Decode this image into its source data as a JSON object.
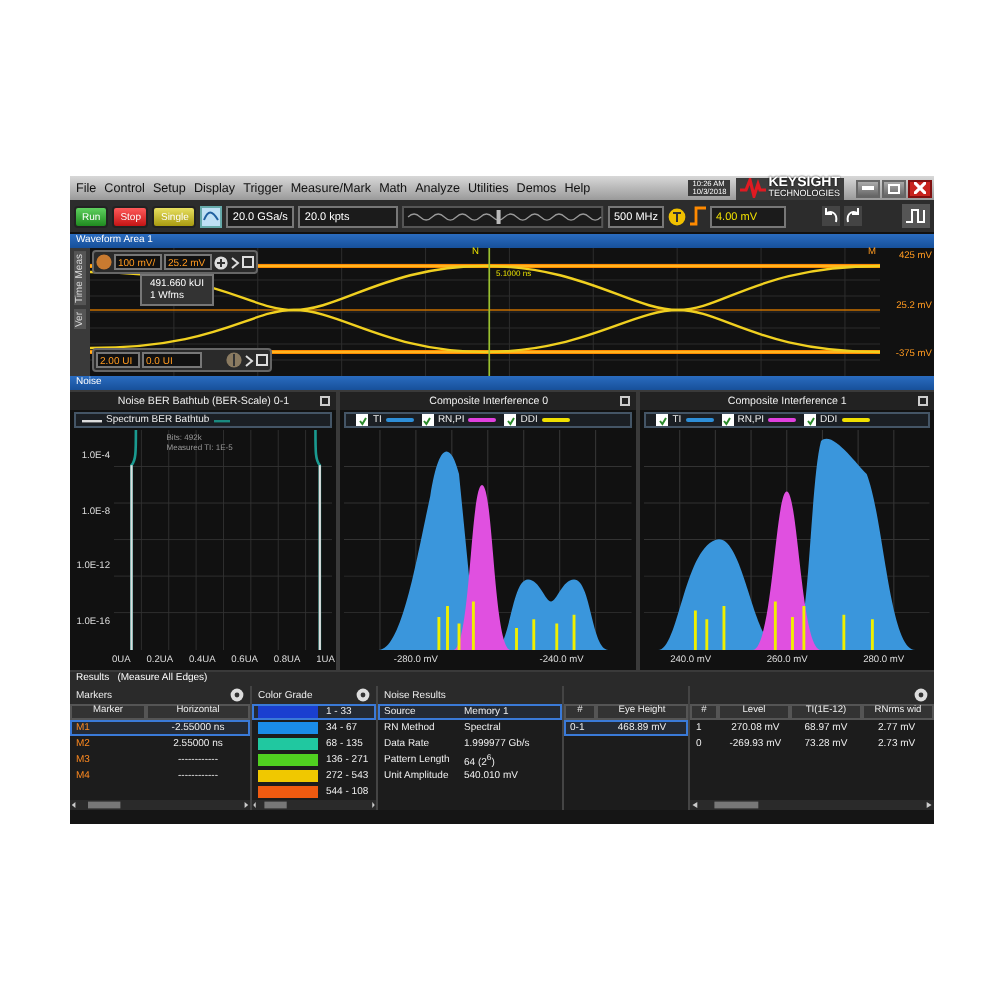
{
  "menu_bar": {
    "items": [
      "File",
      "Control",
      "Setup",
      "Display",
      "Trigger",
      "Measure/Mark",
      "Math",
      "Analyze",
      "Utilities",
      "Demos",
      "Help"
    ],
    "time": "10:26 AM",
    "date": "10/3/2018",
    "logo": {
      "name": "KEYSIGHT",
      "tagline": "TECHNOLOGIES"
    }
  },
  "toolbar": {
    "buttons": [
      {
        "label": "Run",
        "kind": "run"
      },
      {
        "label": "Stop",
        "kind": "stop"
      },
      {
        "label": "Single",
        "kind": "single"
      }
    ],
    "sample_rate": "20.0 GSa/s",
    "memory_depth": "20.0 kpts",
    "bandwidth": "500 MHz",
    "trigger_level": "4.00 mV"
  },
  "waveform_area": {
    "title": "Waveform Area 1",
    "side_tabs": [
      "Time Meas",
      "Ver"
    ],
    "scale": "100 mV/",
    "offset": "25.2 mV",
    "readout": [
      "491.660 kUI",
      "1 Wfms"
    ],
    "timebase": "2.00 UI",
    "position": "0.0 UI",
    "marker_top": "N",
    "time_readout": "5.1000 ns",
    "marker_right": "M",
    "y_labels": [
      "425 mV",
      "25.2 mV",
      "-375 mV"
    ]
  },
  "noise": {
    "title": "Noise",
    "panels": [
      {
        "kind": "bathtub",
        "title": "Noise BER Bathtub (BER-Scale) 0-1",
        "legend": [
          {
            "label": "Spectrum BER Bathtub"
          }
        ],
        "notes": [
          "Bits: 492k",
          "Measured TI: 1E-5"
        ],
        "y_labels": [
          "1.0E-4",
          "1.0E-8",
          "1.0E-12",
          "1.0E-16"
        ],
        "x_labels": [
          "0UA",
          "0.2UA",
          "0.4UA",
          "0.6UA",
          "0.8UA",
          "1UA"
        ]
      },
      {
        "kind": "interference",
        "title": "Composite Interference 0",
        "legend": [
          {
            "label": "TI",
            "checked": true,
            "color": "#2e8fd8"
          },
          {
            "label": "RN,PI",
            "checked": true,
            "color": "#e040e0"
          },
          {
            "label": "DDI",
            "checked": true,
            "color": "#f0e000"
          }
        ],
        "x_labels": [
          "-280.0 mV",
          "-240.0 mV"
        ]
      },
      {
        "kind": "interference",
        "title": "Composite Interference 1",
        "legend": [
          {
            "label": "TI",
            "checked": true,
            "color": "#2e8fd8"
          },
          {
            "label": "RN,PI",
            "checked": true,
            "color": "#e040e0"
          },
          {
            "label": "DDI",
            "checked": true,
            "color": "#f0e000"
          }
        ],
        "x_labels": [
          "240.0 mV",
          "260.0 mV",
          "280.0 mV"
        ]
      }
    ]
  },
  "results": {
    "title": "Results",
    "subtitle": "(Measure All Edges)",
    "markers": {
      "title": "Markers",
      "columns": [
        "Marker",
        "Horizontal"
      ],
      "rows": [
        {
          "marker": "M1",
          "horizontal": "-2.55000 ns",
          "selected": true
        },
        {
          "marker": "M2",
          "horizontal": "2.55000 ns",
          "selected": false
        },
        {
          "marker": "M3",
          "horizontal": "------------",
          "selected": false
        },
        {
          "marker": "M4",
          "horizontal": "------------",
          "selected": false
        }
      ]
    },
    "color_grade": {
      "title": "Color Grade",
      "rows": [
        {
          "range": "1 - 33",
          "color": "#1a3fd0",
          "selected": true
        },
        {
          "range": "34 - 67",
          "color": "#1a8ce8",
          "selected": false
        },
        {
          "range": "68 - 135",
          "color": "#20c8a0",
          "selected": false
        },
        {
          "range": "136 - 271",
          "color": "#50d020",
          "selected": false
        },
        {
          "range": "272 - 543",
          "color": "#f0c800",
          "selected": false
        },
        {
          "range": "544 - 108",
          "color": "#f05a10",
          "selected": false
        }
      ]
    },
    "noise_results": {
      "title": "Noise Results",
      "rows": [
        {
          "label": "Source",
          "value": "Memory 1",
          "selected": true
        },
        {
          "label": "RN Method",
          "value": "Spectral",
          "selected": false
        },
        {
          "label": "Data Rate",
          "value": "1.999977 Gb/s",
          "selected": false
        },
        {
          "label": "Pattern Length",
          "value": "64 (2$^{6}$)",
          "selected": false
        },
        {
          "label": "Unit Amplitude",
          "value": "540.010 mV",
          "selected": false
        }
      ]
    },
    "eye_height": {
      "columns": [
        "#",
        "Eye Height"
      ],
      "rows": [
        {
          "cells": [
            "0-1",
            "468.89 mV"
          ],
          "selected": true
        }
      ]
    },
    "levels": {
      "columns": [
        "#",
        "Level",
        "TI(1E-12)",
        "RNrms wid"
      ],
      "rows": [
        {
          "cells": [
            "1",
            "270.08 mV",
            "68.97 mV",
            "2.77 mV"
          ]
        },
        {
          "cells": [
            "0",
            "-269.93 mV",
            "73.28 mV",
            "2.73 mV"
          ]
        }
      ]
    }
  }
}
